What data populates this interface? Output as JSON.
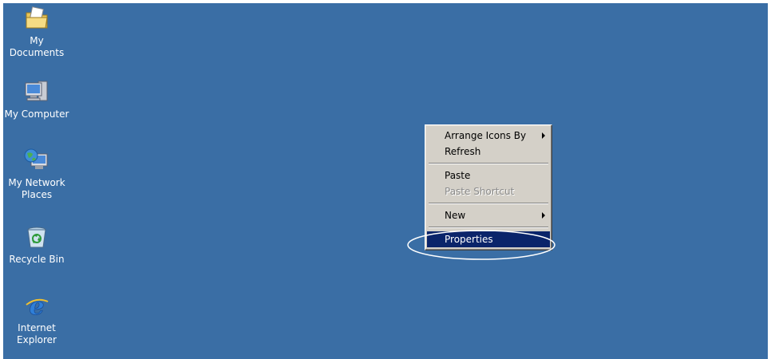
{
  "desktop": {
    "background_color": "#3a6ea5",
    "icons": [
      {
        "label": "My Documents",
        "icon": "my-documents-icon"
      },
      {
        "label": "My Computer",
        "icon": "my-computer-icon"
      },
      {
        "label": "My Network Places",
        "icon": "my-network-places-icon"
      },
      {
        "label": "Recycle Bin",
        "icon": "recycle-bin-icon"
      },
      {
        "label": "Internet Explorer",
        "icon": "internet-explorer-icon"
      }
    ]
  },
  "context_menu": {
    "items": [
      {
        "label": "Arrange Icons By",
        "has_submenu": true,
        "enabled": true
      },
      {
        "label": "Refresh",
        "has_submenu": false,
        "enabled": true
      },
      {
        "label": "Paste",
        "has_submenu": false,
        "enabled": true
      },
      {
        "label": "Paste Shortcut",
        "has_submenu": false,
        "enabled": false
      },
      {
        "label": "New",
        "has_submenu": true,
        "enabled": true
      },
      {
        "label": "Properties",
        "has_submenu": false,
        "enabled": true,
        "highlighted": true
      }
    ],
    "highlight_color": "#0a246a"
  }
}
